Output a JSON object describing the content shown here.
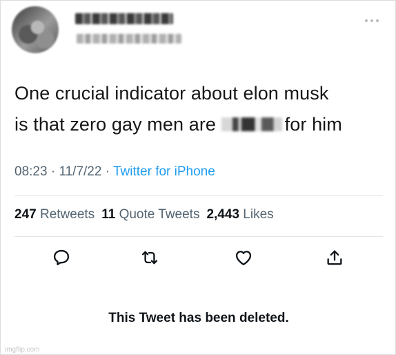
{
  "tweet": {
    "text_line1": "One crucial indicator about elon musk",
    "text_line2_before": "is that zero gay men are",
    "text_line2_after": "for him",
    "time": "08:23",
    "date": "11/7/22",
    "source": "Twitter for iPhone",
    "separator": "·"
  },
  "stats": {
    "retweets_count": "247",
    "retweets_label": "Retweets",
    "quote_count": "11",
    "quote_label": "Quote Tweets",
    "likes_count": "2,443",
    "likes_label": "Likes"
  },
  "actions": {
    "reply_icon": "reply-icon",
    "retweet_icon": "retweet-icon",
    "like_icon": "like-icon",
    "share_icon": "share-icon"
  },
  "deleted_message": "This Tweet has been deleted.",
  "watermark": "imgflip.com",
  "colors": {
    "link": "#1d9bf0",
    "secondary": "#536471",
    "primary": "#0f1419"
  }
}
